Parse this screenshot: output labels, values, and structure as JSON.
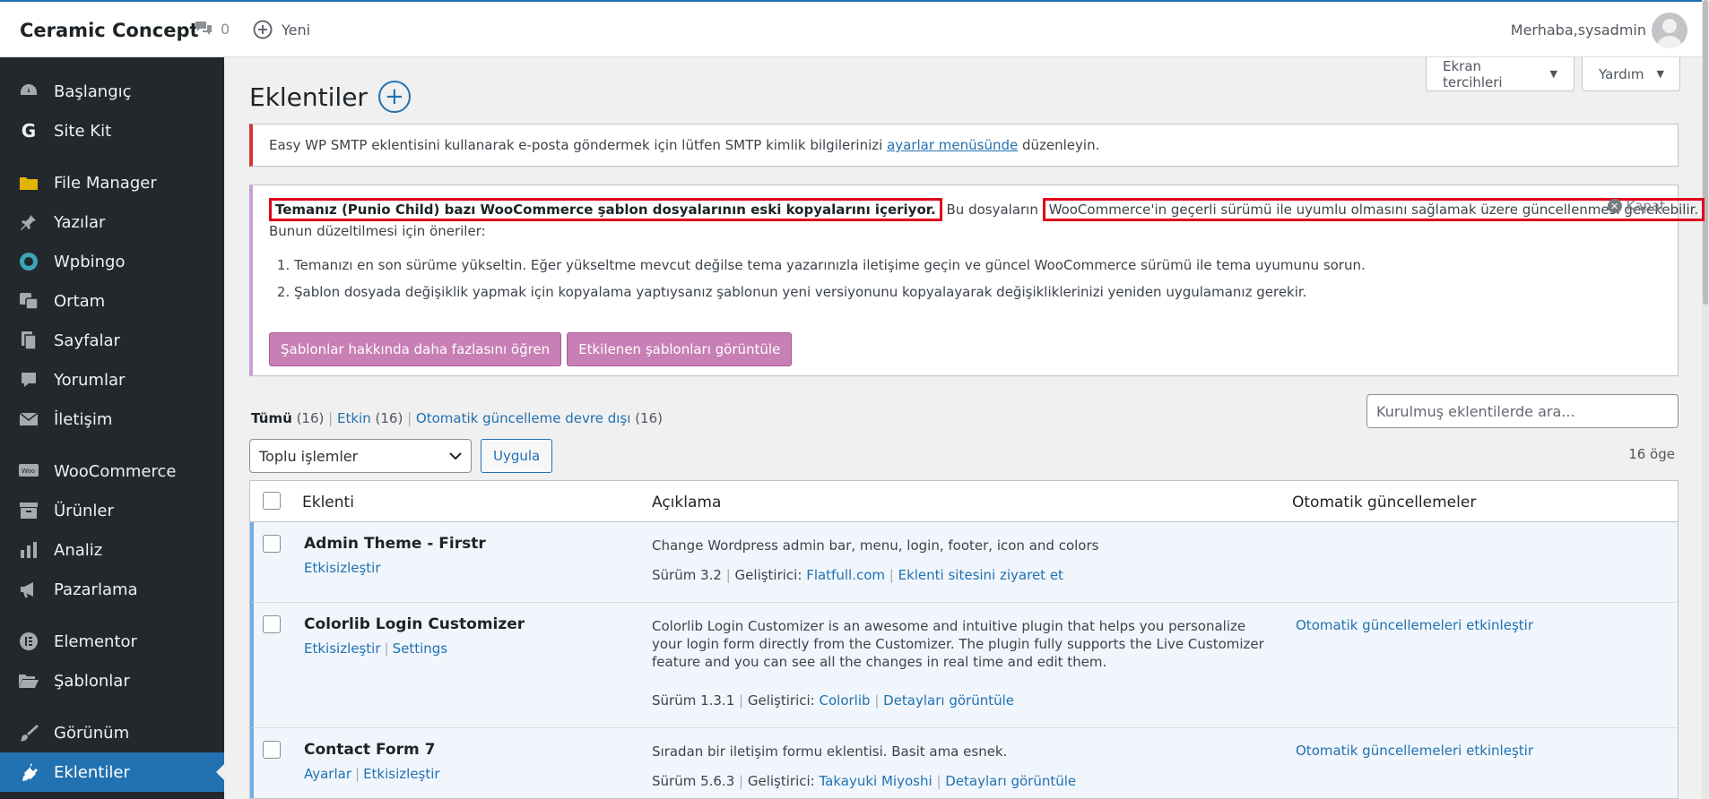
{
  "topbar": {
    "site_name": "Ceramic Concept",
    "comments_count": "0",
    "new_label": "Yeni",
    "greeting": "Merhaba,sysadmin"
  },
  "sidebar": {
    "items": [
      {
        "label": "Başlangıç",
        "icon": "dashboard-icon"
      },
      {
        "label": "Site Kit",
        "icon": "google-icon"
      },
      {
        "label": "File Manager",
        "icon": "folder-icon"
      },
      {
        "label": "Yazılar",
        "icon": "pin-icon"
      },
      {
        "label": "Wpbingo",
        "icon": "wpbingo-icon"
      },
      {
        "label": "Ortam",
        "icon": "media-icon"
      },
      {
        "label": "Sayfalar",
        "icon": "pages-icon"
      },
      {
        "label": "Yorumlar",
        "icon": "comment-icon"
      },
      {
        "label": "İletişim",
        "icon": "mail-icon"
      },
      {
        "label": "WooCommerce",
        "icon": "woocommerce-icon"
      },
      {
        "label": "Ürünler",
        "icon": "archive-icon"
      },
      {
        "label": "Analiz",
        "icon": "chart-bar-icon"
      },
      {
        "label": "Pazarlama",
        "icon": "megaphone-icon"
      },
      {
        "label": "Elementor",
        "icon": "elementor-icon"
      },
      {
        "label": "Şablonlar",
        "icon": "folder-open-icon"
      },
      {
        "label": "Görünüm",
        "icon": "brush-icon"
      },
      {
        "label": "Eklentiler",
        "icon": "plugin-icon"
      }
    ]
  },
  "header": {
    "screen_options": "Ekran tercihleri",
    "help": "Yardım",
    "page_title": "Eklentiler"
  },
  "notice_smtp": {
    "text_before": "Easy WP SMTP eklentisini kullanarak e-posta göndermek için lütfen SMTP kimlik bilgilerinizi ",
    "link": "ayarlar menüsünde",
    "text_after": " düzenleyin."
  },
  "notice_woo": {
    "bold": "Temanız (Punio Child) bazı WooCommerce şablon dosyalarının eski kopyalarını içeriyor.",
    "mid": " Bu dosyaların ",
    "highlight2": "WooCommerce'in geçerli sürümü ile uyumlu olmasını sağlamak üzere güncellenmesi gerekebilir.",
    "line2": "Bunun düzeltilmesi için öneriler:",
    "list": [
      "Temanızı en son sürüme yükseltin. Eğer yükseltme mevcut değilse tema yazarınızla iletişime geçin ve güncel WooCommerce sürümü ile tema uyumunu sorun.",
      "Şablon dosyada değişiklik yapmak için kopyalama yaptıysanız şablonun yeni versiyonunu kopyalayarak değişikliklerinizi yeniden uygulamanız gerekir."
    ],
    "dismiss": "Kapat",
    "btn_learn": "Şablonlar hakkında daha fazlasını öğren",
    "btn_view": "Etkilenen şablonları görüntüle"
  },
  "filters": {
    "all": "Tümü",
    "all_count": "(16)",
    "active": "Etkin",
    "active_count": "(16)",
    "autoupdate_off": "Otomatik güncelleme devre dışı",
    "autoupdate_off_count": "(16)",
    "search_placeholder": "Kurulmuş eklentilerde ara...",
    "bulk_label": "Toplu işlemler",
    "apply": "Uygula",
    "item_count": "16 öge"
  },
  "table": {
    "col_plugin": "Eklenti",
    "col_desc": "Açıklama",
    "col_auto": "Otomatik güncellemeler",
    "rows": [
      {
        "name": "Admin Theme - Firstr",
        "actions": [
          "Etkisizleştir"
        ],
        "desc": "Change Wordpress admin bar, menu, login, footer, icon and colors",
        "version": "Sürüm 3.2",
        "dev_label": "Geliştirici:",
        "dev": "Flatfull.com",
        "link": "Eklenti sitesini ziyaret et",
        "auto": ""
      },
      {
        "name": "Colorlib Login Customizer",
        "actions": [
          "Etkisizleştir",
          "Settings"
        ],
        "desc": "Colorlib Login Customizer is an awesome and intuitive plugin that helps you personalize your login form directly from the Customizer. The plugin fully supports the Live Customizer feature and you can see all the changes in real time and edit them.",
        "version": "Sürüm 1.3.1",
        "dev_label": "Geliştirici:",
        "dev": "Colorlib",
        "link": "Detayları görüntüle",
        "auto": "Otomatik güncellemeleri etkinleştir"
      },
      {
        "name": "Contact Form 7",
        "actions": [
          "Ayarlar",
          "Etkisizleştir"
        ],
        "desc": "Sıradan bir iletişim formu eklentisi. Basit ama esnek.",
        "version": "Sürüm 5.6.3",
        "dev_label": "Geliştirici:",
        "dev": "Takayuki Miyoshi",
        "link": "Detayları görüntüle",
        "auto": "Otomatik güncellemeleri etkinleştir"
      }
    ]
  },
  "colors": {
    "accent": "#2271b1",
    "sidebar_bg": "#23282d",
    "error_border": "#d63638",
    "woo_purple": "#c77fb5",
    "highlight_red": "#e0001b"
  }
}
